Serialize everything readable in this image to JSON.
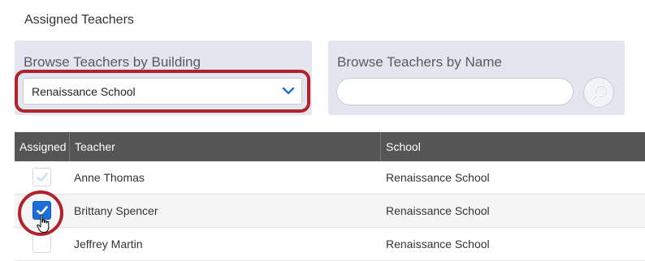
{
  "page": {
    "title": "Assigned Teachers"
  },
  "building_filter": {
    "label": "Browse Teachers by Building",
    "selected_value": "Renaissance School"
  },
  "name_filter": {
    "label": "Browse Teachers by Name",
    "value": "",
    "placeholder": ""
  },
  "table": {
    "headers": {
      "assigned": "Assigned",
      "teacher": "Teacher",
      "school": "School"
    },
    "rows": [
      {
        "teacher": "Anne Thomas",
        "school": "Renaissance School",
        "assigned": true,
        "enabled": false
      },
      {
        "teacher": "Brittany Spencer",
        "school": "Renaissance School",
        "assigned": true,
        "enabled": true
      },
      {
        "teacher": "Jeffrey Martin",
        "school": "Renaissance School",
        "assigned": false,
        "enabled": true
      }
    ]
  },
  "colors": {
    "accent": "#1c6fd8",
    "highlight": "#b1232c",
    "header_bg": "#555555",
    "panel_bg": "#e3e6ee"
  },
  "icons": {
    "dropdown": "chevron-down-icon",
    "search": "search-icon",
    "checkbox": "checkmark-icon",
    "cursor": "hand-cursor-icon"
  }
}
